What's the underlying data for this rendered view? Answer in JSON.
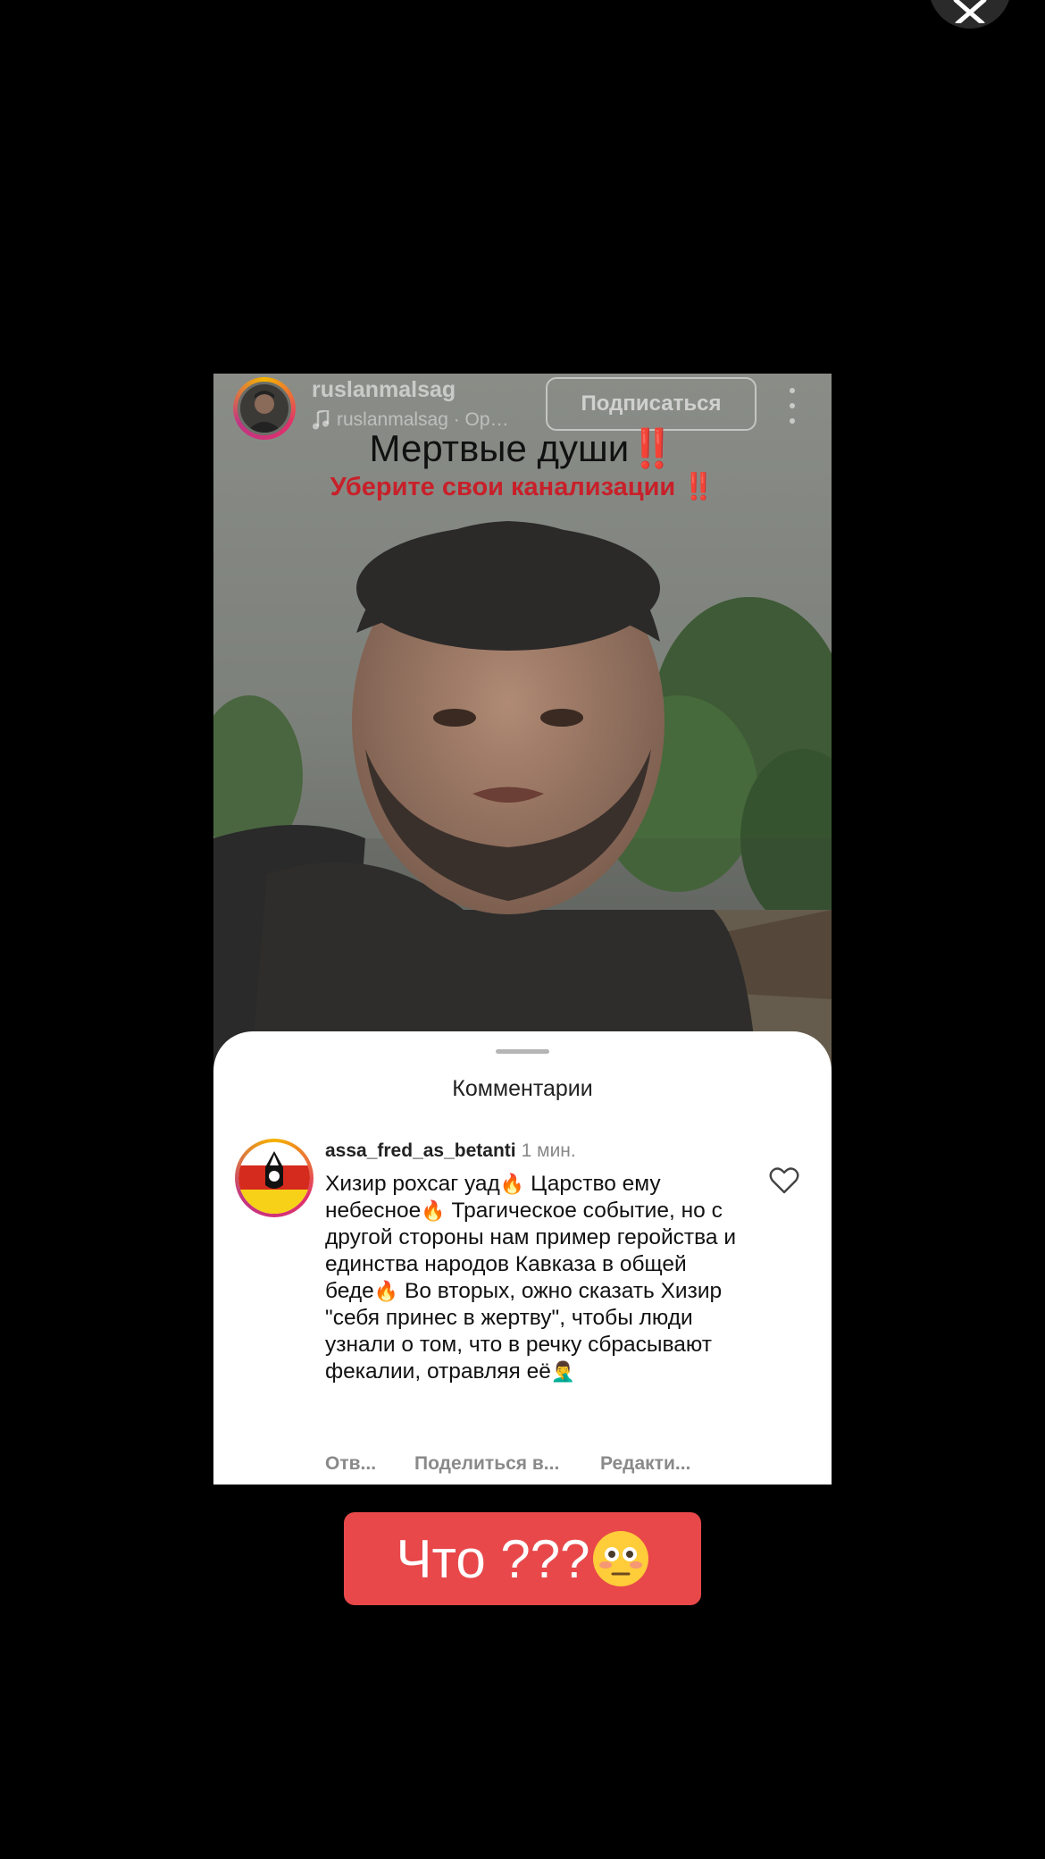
{
  "story": {
    "username": "ruslanmalsag",
    "music": "ruslanmalsag · Ор…",
    "follow_label": "Подписаться",
    "overlay_title": "Мертвые души",
    "overlay_title_marks": "‼️",
    "overlay_sub": "Уберите свои канализации",
    "overlay_sub_marks": "‼️"
  },
  "comments": {
    "title": "Комментарии",
    "item": {
      "username": "assa_fred_as_betanti",
      "time": "1 мин.",
      "text_parts": [
        "Хизир рохсаг уад",
        " Царство ему небесное",
        " Трагическое событие, но с другой стороны нам пример геройства и единства народов Кавказа в общей беде",
        " Во вторых, ожно сказать Хизир \"себя принес в жертву\", чтобы люди узнали о том, что в речку сбрасывают фекалии, отравляя её"
      ],
      "fire_emoji": "🔥",
      "end_emoji": "🤦‍♂️",
      "reply_label": "Отв...",
      "share_label": "Поделиться в...",
      "edit_label": "Редакти..."
    }
  },
  "caption": {
    "text": "Что ???",
    "emoji": "😳",
    "color": "#e8484a"
  }
}
